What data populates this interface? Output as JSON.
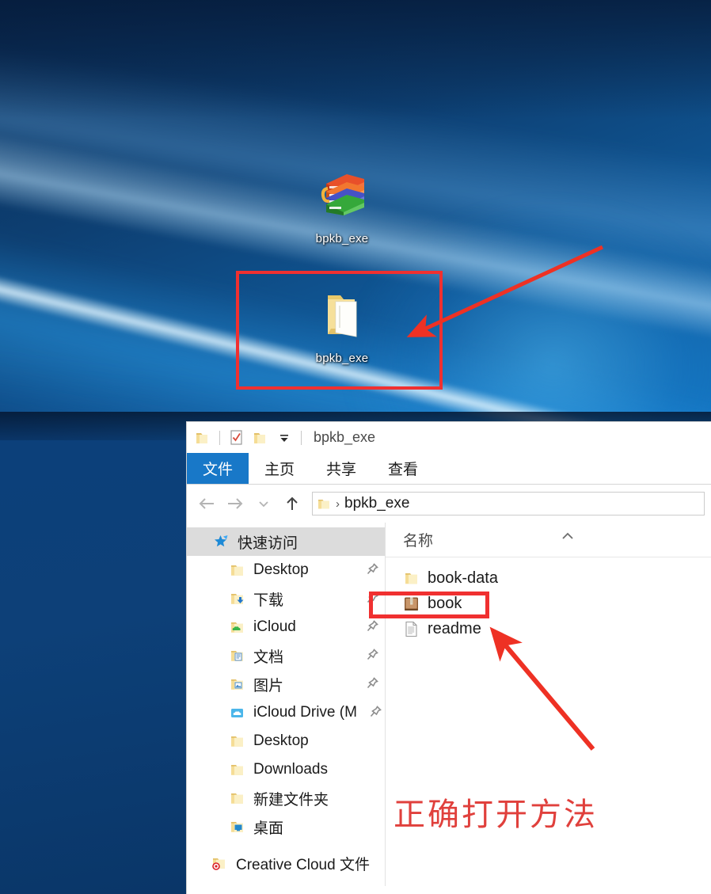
{
  "desktop": {
    "icons": [
      {
        "name": "bpkb_exe",
        "icon": "winrar-archive-icon",
        "type": "archive"
      },
      {
        "name": "bpkb_exe",
        "icon": "folder-icon",
        "type": "folder"
      }
    ]
  },
  "annotations": {
    "callout_text": "正确打开方法",
    "callout_color": "#e0403c",
    "highlight_color": "#f03030",
    "arrow_color": "#ee3124"
  },
  "explorer": {
    "quick_access_toolbar": {
      "title": "bpkb_exe",
      "buttons": [
        {
          "name": "properties-folder-icon",
          "label": "属性"
        },
        {
          "name": "properties-icon",
          "label": "属性"
        },
        {
          "name": "new-folder-icon",
          "label": "新建文件夹"
        },
        {
          "name": "customize-dropdown-icon",
          "label": "自定义快速访问工具栏"
        }
      ]
    },
    "ribbon_tabs": [
      {
        "label": "文件",
        "active": true
      },
      {
        "label": "主页",
        "active": false
      },
      {
        "label": "共享",
        "active": false
      },
      {
        "label": "查看",
        "active": false
      }
    ],
    "navigation": {
      "back_label": "后退",
      "forward_label": "前进",
      "recent_label": "最近浏览的位置",
      "up_label": "上移一级",
      "breadcrumb_root_icon": "folder-icon",
      "breadcrumb": "bpkb_exe",
      "breadcrumb_separator": "›"
    },
    "sidebar": {
      "header": {
        "label": "快速访问",
        "icon": "star-pin-icon"
      },
      "items": [
        {
          "label": "Desktop",
          "icon": "folder-icon",
          "pinned": true
        },
        {
          "label": "下载",
          "icon": "downloads-folder-icon",
          "pinned": true
        },
        {
          "label": "iCloud",
          "icon": "icloud-folder-icon",
          "pinned": true
        },
        {
          "label": "文档",
          "icon": "documents-folder-icon",
          "pinned": true
        },
        {
          "label": "图片",
          "icon": "pictures-folder-icon",
          "pinned": true
        },
        {
          "label": "iCloud Drive (M",
          "icon": "icloud-drive-icon",
          "pinned": true
        },
        {
          "label": "Desktop",
          "icon": "folder-icon",
          "pinned": false
        },
        {
          "label": "Downloads",
          "icon": "folder-icon",
          "pinned": false
        },
        {
          "label": "新建文件夹",
          "icon": "folder-icon",
          "pinned": false
        },
        {
          "label": "桌面",
          "icon": "desktop-folder-icon",
          "pinned": false
        }
      ],
      "groups": [
        {
          "label": "Creative Cloud 文件",
          "icon": "creative-cloud-folder-icon"
        }
      ]
    },
    "file_list": {
      "column_header": "名称",
      "sort_indicator": "chevron-up-icon",
      "rows": [
        {
          "name": "book-data",
          "icon": "folder-icon",
          "highlighted": false
        },
        {
          "name": "book",
          "icon": "book-app-icon",
          "highlighted": true
        },
        {
          "name": "readme",
          "icon": "text-file-icon",
          "highlighted": false
        }
      ]
    }
  }
}
